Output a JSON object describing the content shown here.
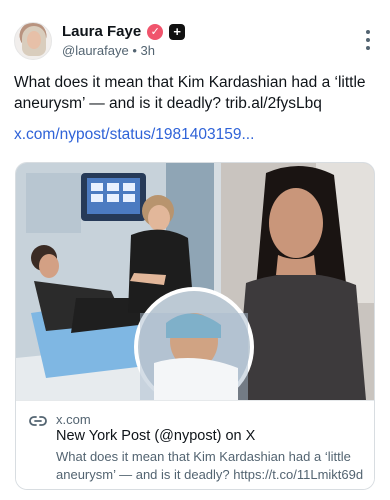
{
  "author": {
    "name": "Laura Faye",
    "handle": "@laurafaye",
    "time": "3h",
    "separator": "•",
    "verified_icon": "check-badge-icon",
    "plus_icon": "plus-square-icon"
  },
  "post": {
    "text": "What does it mean that Kim Kardashian had a ‘little aneurysm’ — and is it deadly? trib.al/2fysLbq",
    "link": "x.com/nypost/status/1981403159..."
  },
  "card": {
    "domain": "x.com",
    "title": "New York Post (@nypost) on X",
    "description": "What does it mean that Kim Kardashian had a ‘little aneurysm’ — and is it deadly? https://t.co/11Lmikt69d"
  },
  "colors": {
    "link": "#2f63d8",
    "muted": "#536471",
    "badge": "#f0546c"
  }
}
